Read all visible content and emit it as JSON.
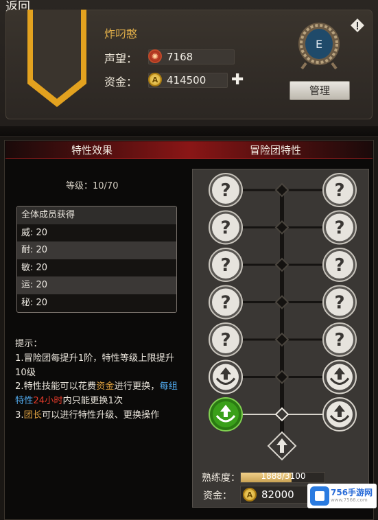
{
  "nav": {
    "back_label": "返回"
  },
  "guild": {
    "name": "炸叼憨",
    "reputation_label": "声望：",
    "reputation_value": "7168",
    "funds_label": "资金：",
    "funds_value": "414500",
    "emblem_letter": "E",
    "manage_label": "管理"
  },
  "tabs": {
    "left_title": "特性效果",
    "right_title": "冒险团特性"
  },
  "traits": {
    "level_text": "等级：10/70",
    "bonus_header": "全体成员获得",
    "bonus_rows": [
      "威: 20",
      "耐: 20",
      "敏: 20",
      "运: 20",
      "秘: 20"
    ]
  },
  "tips": {
    "title": "提示：",
    "line1": "1.冒险团每提升1阶，特性等级上限提升10级",
    "line2_a": "2.特性技能可以花费",
    "line2_gold": "资金",
    "line2_b": "进行更换，",
    "line2_blue": "每组特性",
    "line2_red": "24小时",
    "line2_c": "内只能更换1次",
    "line3_a": "3.",
    "line3_gold": "团长",
    "line3_b": "可以进行特性升级、更换操作"
  },
  "tree": {
    "rows": [
      {
        "left": "locked",
        "right": "locked"
      },
      {
        "left": "locked",
        "right": "locked"
      },
      {
        "left": "locked",
        "right": "locked"
      },
      {
        "left": "locked",
        "right": "locked"
      },
      {
        "left": "locked",
        "right": "locked"
      },
      {
        "left": "upgrade",
        "right": "upgrade"
      },
      {
        "left": "upgrade-active",
        "right": "upgrade"
      }
    ],
    "proficiency_label": "熟练度：",
    "proficiency_text": "1888/3100",
    "proficiency_value": 1888,
    "proficiency_max": 3100,
    "funds_label": "资金：",
    "funds_value": "82000"
  },
  "watermark": {
    "brand": "756手游网",
    "sub": "www.7566.com"
  },
  "colors": {
    "accent_gold": "#e3b04a",
    "header_red": "#8a1616",
    "active_green": "#3aa01a"
  }
}
